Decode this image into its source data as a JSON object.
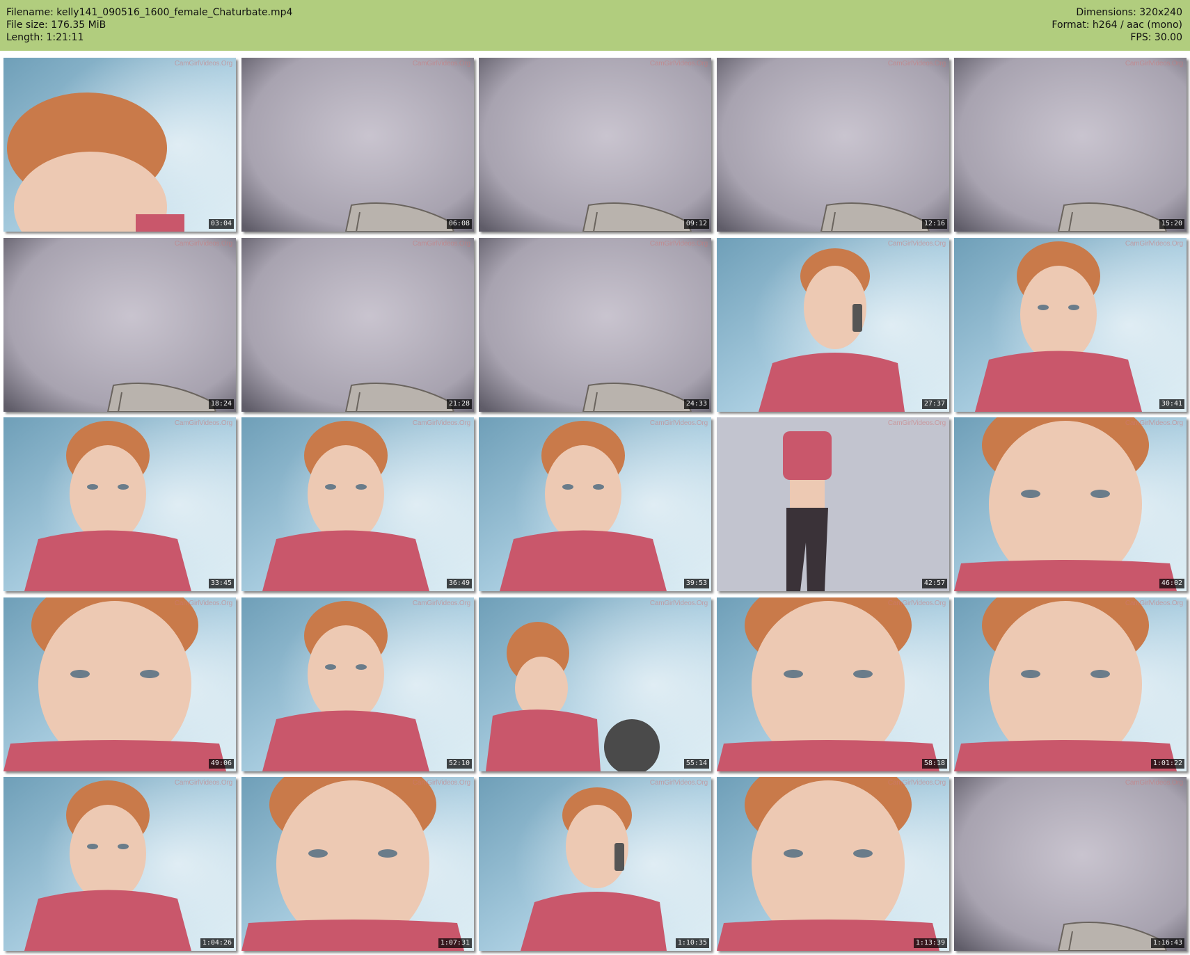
{
  "header": {
    "filename": "Filename: kelly141_090516_1600_female_Chaturbate.mp4",
    "filesize": "File size: 176.35 MiB",
    "length": "Length: 1:21:11",
    "dimensions": "Dimensions: 320x240",
    "format": "Format: h264 / aac (mono)",
    "fps": "FPS: 30.00",
    "background_color": "#b1cd7e"
  },
  "watermark": "CamGirlVideos.Org",
  "thumbnails": [
    {
      "time": "03:04",
      "scene": "forehead"
    },
    {
      "time": "06:08",
      "scene": "wall"
    },
    {
      "time": "09:12",
      "scene": "wall"
    },
    {
      "time": "12:16",
      "scene": "wall"
    },
    {
      "time": "15:20",
      "scene": "wall"
    },
    {
      "time": "18:24",
      "scene": "wall"
    },
    {
      "time": "21:28",
      "scene": "wall"
    },
    {
      "time": "24:33",
      "scene": "wall"
    },
    {
      "time": "27:37",
      "scene": "phone"
    },
    {
      "time": "30:41",
      "scene": "portrait"
    },
    {
      "time": "33:45",
      "scene": "portrait"
    },
    {
      "time": "36:49",
      "scene": "portrait"
    },
    {
      "time": "39:53",
      "scene": "portrait"
    },
    {
      "time": "42:57",
      "scene": "standing"
    },
    {
      "time": "46:02",
      "scene": "closeup"
    },
    {
      "time": "49:06",
      "scene": "closeup"
    },
    {
      "time": "52:10",
      "scene": "portrait"
    },
    {
      "time": "55:14",
      "scene": "looking-down"
    },
    {
      "time": "58:18",
      "scene": "closeup"
    },
    {
      "time": "1:01:22",
      "scene": "closeup"
    },
    {
      "time": "1:04:26",
      "scene": "portrait"
    },
    {
      "time": "1:07:31",
      "scene": "closeup"
    },
    {
      "time": "1:10:35",
      "scene": "phone"
    },
    {
      "time": "1:13:39",
      "scene": "closeup"
    },
    {
      "time": "1:16:43",
      "scene": "wall"
    }
  ]
}
